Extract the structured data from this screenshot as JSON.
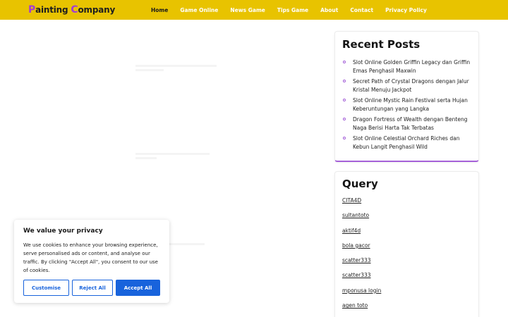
{
  "header": {
    "logo_first_letter": "P",
    "logo_part1": "ainting ",
    "logo_second_letter": "C",
    "logo_part2": "ompany",
    "nav": [
      "Home",
      "Game Online",
      "News Game",
      "Tips Game",
      "About",
      "Contact",
      "Privacy Policy"
    ],
    "active": "Home",
    "bar_color": "#e8c300",
    "accent": "#a23bd6"
  },
  "sidebar": {
    "recent_title": "Recent Posts",
    "recent_posts": [
      "Slot Online Golden Griffin Legacy dan Griffin Emas Penghasil Maxwin",
      "Secret Path of Crystal Dragons dengan Jalur Kristal Menuju Jackpot",
      "Slot Online Mystic Rain Festival serta Hujan Keberuntungan yang Langka",
      "Dragon Fortress of Wealth dengan Benteng Naga Berisi Harta Tak Terbatas",
      "Slot Online Celestial Orchard Riches dan Kebun Langit Penghasil Wild"
    ],
    "query_title": "Query",
    "query_links": [
      "CITA4D",
      "sultantoto",
      "aktif4d",
      "bola gacor",
      "scatter333",
      "scatter333",
      "mponusa login",
      "agen toto"
    ]
  },
  "cookie": {
    "title": "We value your privacy",
    "text": "We use cookies to enhance your browsing experience, serve personalised ads or content, and analyse our traffic. By clicking \"Accept All\", you consent to our use of cookies.",
    "customise_label": "Customise",
    "reject_label": "Reject All",
    "accept_label": "Accept All",
    "button_color": "#1863dc"
  }
}
